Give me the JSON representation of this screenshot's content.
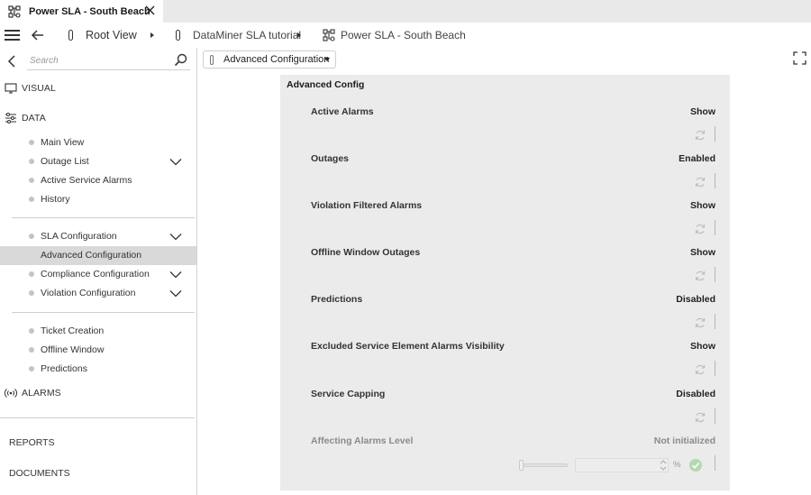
{
  "tab": {
    "title": "Power SLA - South Beach",
    "icon": "service-icon"
  },
  "breadcrumb": {
    "items": [
      {
        "label": "Root View"
      },
      {
        "label": "DataMiner SLA tutorial"
      },
      {
        "label": "Power SLA - South Beach"
      }
    ]
  },
  "search": {
    "placeholder": "Search"
  },
  "sidebar": {
    "visual_label": "VISUAL",
    "data_label": "DATA",
    "group1": [
      {
        "label": "Main View",
        "has_children": false
      },
      {
        "label": "Outage List",
        "has_children": true
      },
      {
        "label": "Active Service Alarms",
        "has_children": false
      },
      {
        "label": "History",
        "has_children": false
      }
    ],
    "group2": [
      {
        "label": "SLA Configuration",
        "has_children": true
      },
      {
        "label": "Advanced Configuration",
        "has_children": false,
        "selected": true
      },
      {
        "label": "Compliance Configuration",
        "has_children": true
      },
      {
        "label": "Violation Configuration",
        "has_children": true
      }
    ],
    "group3": [
      {
        "label": "Ticket Creation",
        "has_children": false
      },
      {
        "label": "Offline Window",
        "has_children": false
      },
      {
        "label": "Predictions",
        "has_children": false
      }
    ],
    "alarms_label": "ALARMS",
    "reports_label": "REPORTS",
    "documents_label": "DOCUMENTS"
  },
  "page_selector": {
    "value": "Advanced Configuration"
  },
  "card": {
    "title": "Advanced Config",
    "rows": [
      {
        "label": "Active Alarms",
        "value": "Show"
      },
      {
        "label": "Outages",
        "value": "Enabled"
      },
      {
        "label": "Violation Filtered Alarms",
        "value": "Show"
      },
      {
        "label": "Offline Window Outages",
        "value": "Show"
      },
      {
        "label": "Predictions",
        "value": "Disabled"
      },
      {
        "label": "Excluded Service Element Alarms Visibility",
        "value": "Show"
      },
      {
        "label": "Service Capping",
        "value": "Disabled"
      }
    ],
    "last_row": {
      "label": "Affecting Alarms Level",
      "value": "Not initialized",
      "unit": "%"
    }
  },
  "colors": {
    "card_bg": "#ebebeb",
    "selected_item_bg": "#d9d9d9",
    "confirm_green": "#b3d9b3",
    "tab_strip_bg": "#e9e9e9"
  }
}
